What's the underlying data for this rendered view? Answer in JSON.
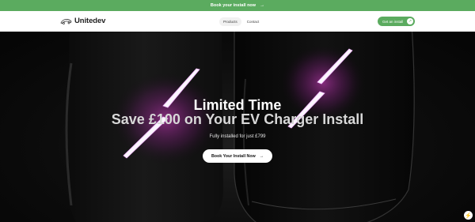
{
  "promo": {
    "text": "Book your install now",
    "arrow": "→"
  },
  "header": {
    "brand": "Unitedev",
    "nav": [
      {
        "label": "Products"
      },
      {
        "label": "Contact"
      }
    ],
    "cta_label": "Get an install",
    "cta_arrow": "↗"
  },
  "hero": {
    "headline_1": "Limited Time",
    "headline_2": "Save £100 on Your EV Charger Install",
    "subtext": "Fully installed for just £799",
    "button_label": "Book Your Install Now",
    "button_arrow": "→"
  },
  "badge": {
    "glyph": "⚡"
  },
  "colors": {
    "brand_green": "#5bab5f",
    "glow_pink": "#e040d0",
    "glow_white": "#f4f0ff"
  }
}
